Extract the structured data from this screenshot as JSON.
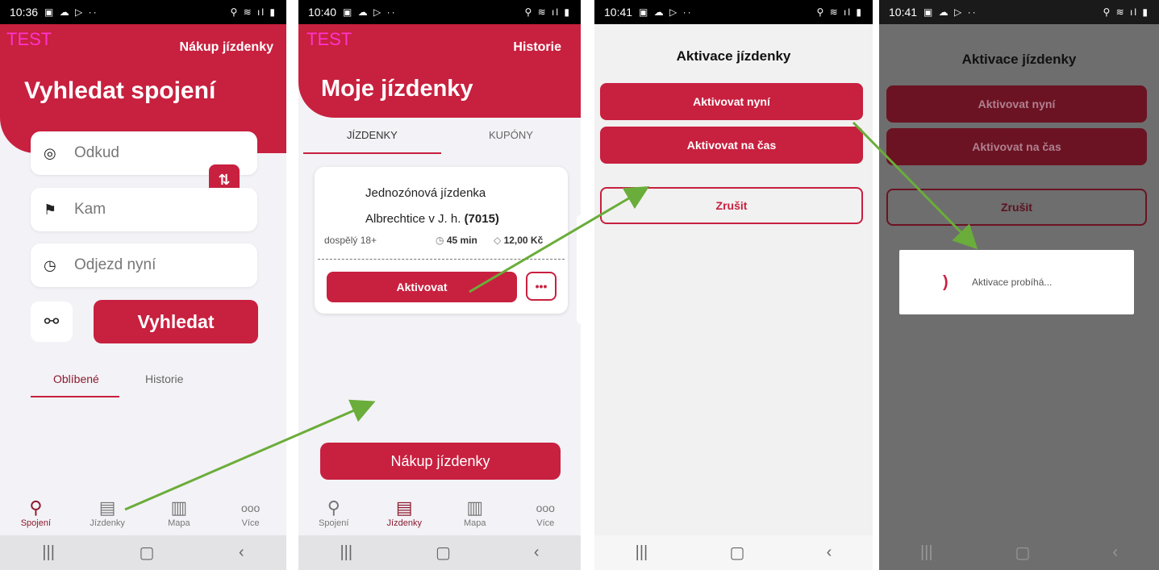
{
  "screens": [
    {
      "status_time": "10:36",
      "test_label": "TEST",
      "header_link": "Nákup jízdenky",
      "title": "Vyhledat spojení",
      "from_placeholder": "Odkud",
      "to_placeholder": "Kam",
      "departure_placeholder": "Odjezd nyní",
      "search_label": "Vyhledat",
      "subtab_favorites": "Oblíbené",
      "subtab_history": "Historie"
    },
    {
      "status_time": "10:40",
      "test_label": "TEST",
      "header_link": "Historie",
      "title": "Moje jízdenky",
      "tab_tickets": "JÍZDENKY",
      "tab_coupons": "KUPÓNY",
      "ticket": {
        "name": "Jednozónová jízdenka",
        "route": "Albrechtice v J. h.",
        "route_code": "(7015)",
        "passenger": "dospělý 18+",
        "duration": "45 min",
        "price": "12,00 Kč",
        "activate_label": "Aktivovat",
        "more_label": "•••"
      },
      "buy_label": "Nákup jízdenky"
    },
    {
      "status_time": "10:41",
      "title": "Aktivace jízdenky",
      "activate_now": "Aktivovat nyní",
      "activate_at_time": "Aktivovat na čas",
      "cancel": "Zrušit"
    },
    {
      "status_time": "10:41",
      "title": "Aktivace jízdenky",
      "activate_now": "Aktivovat nyní",
      "activate_at_time": "Aktivovat na čas",
      "cancel": "Zrušit",
      "dialog_text": "Aktivace probíhá..."
    }
  ],
  "bottom_nav": [
    {
      "label": "Spojení",
      "icon": "search-icon"
    },
    {
      "label": "Jízdenky",
      "icon": "ticket-icon"
    },
    {
      "label": "Mapa",
      "icon": "map-icon"
    },
    {
      "label": "Více",
      "icon": "more-icon"
    }
  ],
  "colors": {
    "brand_red": "#c8203f",
    "test_magenta": "#ff33cc",
    "arrow_green": "#6aad3a"
  }
}
